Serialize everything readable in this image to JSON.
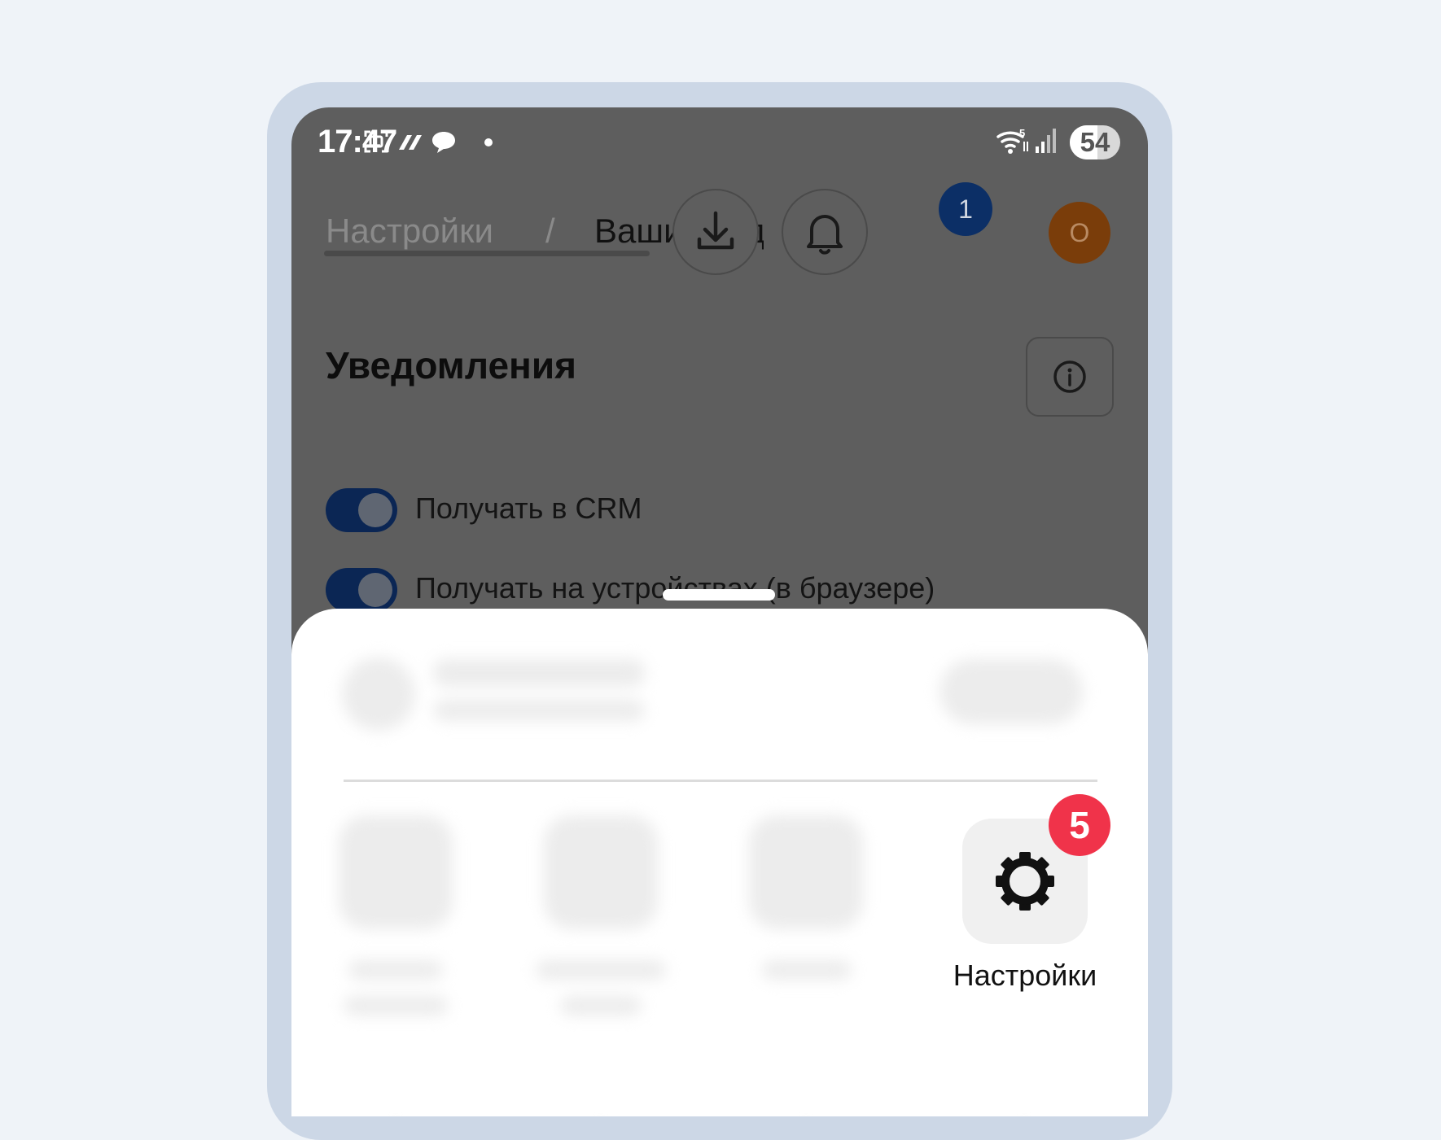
{
  "status_bar": {
    "time": "17:47",
    "battery": "54",
    "icons": [
      "screenshot-icon",
      "slash-icon",
      "chat-bubble-icon",
      "dot-icon",
      "wifi-icon",
      "signal-icon",
      "battery-icon"
    ]
  },
  "header": {
    "breadcrumb_root": "Настройки",
    "breadcrumb_separator": "/",
    "breadcrumb_current": "Ваши увед",
    "notifications_badge": "1",
    "avatar_letter": "О"
  },
  "section": {
    "title": "Уведомления",
    "toggles": [
      {
        "label": "Получать в CRM",
        "on": true
      },
      {
        "label": "Получать на устройствах (в браузере)",
        "on": true
      }
    ]
  },
  "sheet": {
    "settings_tile": {
      "label": "Настройки",
      "badge": "5"
    }
  },
  "colors": {
    "overlay": "#5e5e5e",
    "toggle_on": "#0b2654",
    "badge_blue": "#0c2f66",
    "badge_red": "#f0334a",
    "avatar": "#7a3d0a",
    "frame": "#ccd7e6",
    "page_background": "#eff3f8"
  }
}
